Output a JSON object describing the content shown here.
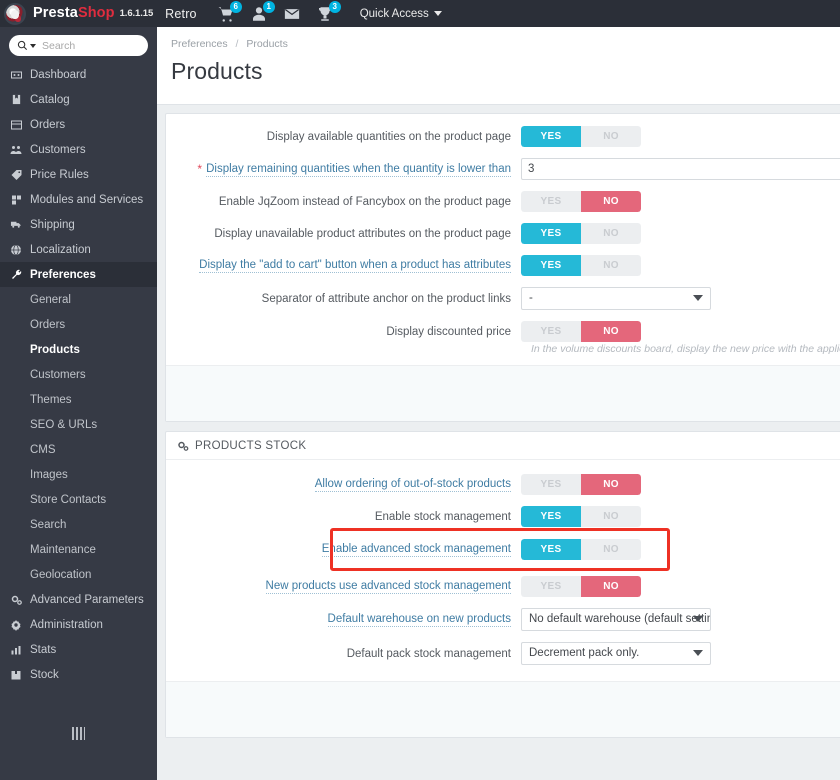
{
  "topbar": {
    "brand_presta": "Presta",
    "brand_shop": "Shop",
    "version": "1.6.1.15",
    "shop_name": "Retro",
    "cart_badge": "6",
    "customers_badge": "1",
    "trophy_badge": "3",
    "quick_access": "Quick Access"
  },
  "sidebar": {
    "search_placeholder": "Search",
    "search_value": "",
    "items": [
      {
        "label": "Dashboard",
        "icon": "dashboard-icon",
        "active": false
      },
      {
        "label": "Catalog",
        "icon": "catalog-icon",
        "active": false
      },
      {
        "label": "Orders",
        "icon": "orders-icon",
        "active": false
      },
      {
        "label": "Customers",
        "icon": "customers-icon",
        "active": false
      },
      {
        "label": "Price Rules",
        "icon": "price-rules-icon",
        "active": false
      },
      {
        "label": "Modules and Services",
        "icon": "modules-icon",
        "active": false
      },
      {
        "label": "Shipping",
        "icon": "shipping-icon",
        "active": false
      },
      {
        "label": "Localization",
        "icon": "localization-icon",
        "active": false
      },
      {
        "label": "Preferences",
        "icon": "preferences-icon",
        "active": true
      }
    ],
    "subitems": [
      {
        "label": "General",
        "active": false
      },
      {
        "label": "Orders",
        "active": false
      },
      {
        "label": "Products",
        "active": true
      },
      {
        "label": "Customers",
        "active": false
      },
      {
        "label": "Themes",
        "active": false
      },
      {
        "label": "SEO & URLs",
        "active": false
      },
      {
        "label": "CMS",
        "active": false
      },
      {
        "label": "Images",
        "active": false
      },
      {
        "label": "Store Contacts",
        "active": false
      },
      {
        "label": "Search",
        "active": false
      },
      {
        "label": "Maintenance",
        "active": false
      },
      {
        "label": "Geolocation",
        "active": false
      }
    ],
    "bottom_items": [
      {
        "label": "Advanced Parameters",
        "icon": "advanced-parameters-icon"
      },
      {
        "label": "Administration",
        "icon": "administration-icon"
      },
      {
        "label": "Stats",
        "icon": "stats-icon"
      },
      {
        "label": "Stock",
        "icon": "stock-icon"
      }
    ]
  },
  "header": {
    "breadcrumb_parent": "Preferences",
    "breadcrumb_sep": "/",
    "breadcrumb_current": "Products",
    "title": "Products"
  },
  "products_panel": {
    "rows": [
      {
        "label": "Display available quantities on the product page",
        "type": "switch",
        "value": "yes",
        "link": false
      },
      {
        "label": "Display remaining quantities when the quantity is lower than",
        "type": "text",
        "value": "3",
        "link": true,
        "required": true
      },
      {
        "label": "Enable JqZoom instead of Fancybox on the product page",
        "type": "switch",
        "value": "no",
        "link": false
      },
      {
        "label": "Display unavailable product attributes on the product page",
        "type": "switch",
        "value": "yes",
        "link": false
      },
      {
        "label": "Display the \"add to cart\" button when a product has attributes",
        "type": "switch",
        "value": "yes",
        "link": true
      },
      {
        "label": "Separator of attribute anchor on the product links",
        "type": "select",
        "value": "-",
        "link": false
      },
      {
        "label": "Display discounted price",
        "type": "switch",
        "value": "no",
        "link": false
      }
    ],
    "help_text": "In the volume discounts board, display the new price with the applied discou"
  },
  "stock_panel": {
    "title": "PRODUCTS STOCK",
    "icon": "gears-icon",
    "rows": [
      {
        "label": "Allow ordering of out-of-stock products",
        "type": "switch",
        "value": "no",
        "link": true,
        "highlighted": false
      },
      {
        "label": "Enable stock management",
        "type": "switch",
        "value": "yes",
        "link": false,
        "highlighted": false
      },
      {
        "label": "Enable advanced stock management",
        "type": "switch",
        "value": "yes",
        "link": true,
        "highlighted": true
      },
      {
        "label": "New products use advanced stock management",
        "type": "switch",
        "value": "no",
        "link": true,
        "highlighted": false
      },
      {
        "label": "Default warehouse on new products",
        "type": "select",
        "value": "No default warehouse (default settin",
        "link": true,
        "highlighted": false
      },
      {
        "label": "Default pack stock management",
        "type": "select",
        "value": "Decrement pack only.",
        "link": false,
        "highlighted": false
      }
    ]
  },
  "switch_labels": {
    "yes": "YES",
    "no": "NO"
  },
  "colors": {
    "toggle_on": "#25b9d7",
    "toggle_no": "#e4677b",
    "toggle_off": "#eceef0",
    "highlight": "#ee3124",
    "sidebar_bg": "#363a45",
    "topbar_bg": "#2b2f38",
    "brand_red": "#df2d3f",
    "badge_blue": "#00b4e2"
  }
}
